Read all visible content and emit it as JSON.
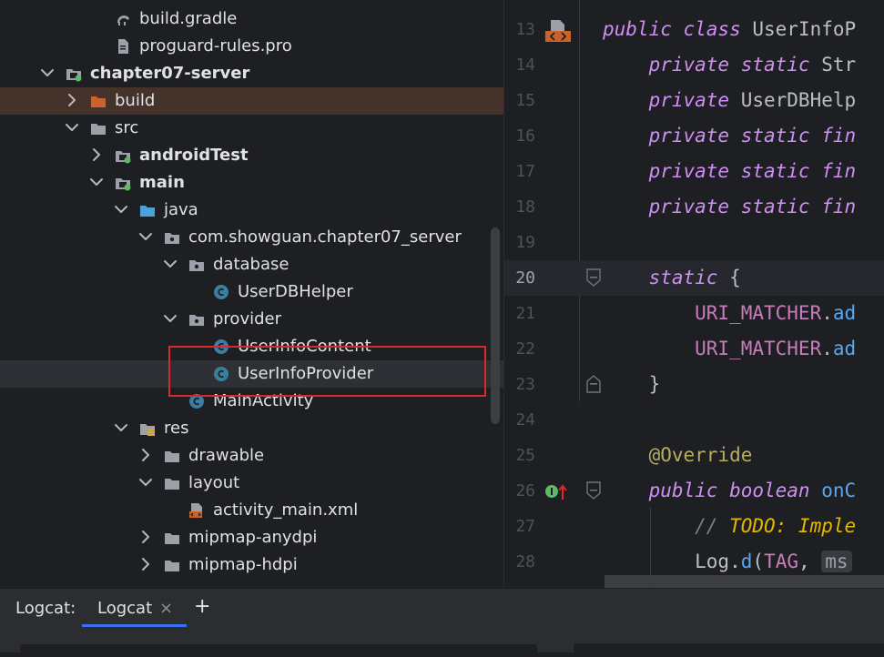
{
  "project_tree": {
    "items": [
      {
        "label": "build.gradle",
        "icon": "gradle-icon",
        "depth": 3,
        "expanded": null,
        "bold": false
      },
      {
        "label": "proguard-rules.pro",
        "icon": "file-icon",
        "depth": 3,
        "expanded": null,
        "bold": false
      },
      {
        "label": "chapter07-server",
        "icon": "module-folder-icon",
        "depth": 1,
        "expanded": true,
        "bold": true
      },
      {
        "label": "build",
        "icon": "build-folder-icon",
        "depth": 2,
        "expanded": false,
        "bold": false
      },
      {
        "label": "src",
        "icon": "folder-icon",
        "depth": 2,
        "expanded": true,
        "bold": false
      },
      {
        "label": "androidTest",
        "icon": "source-set-folder-icon",
        "depth": 3,
        "expanded": false,
        "bold": true
      },
      {
        "label": "main",
        "icon": "source-set-folder-icon",
        "depth": 3,
        "expanded": true,
        "bold": true
      },
      {
        "label": "java",
        "icon": "source-root-folder-icon",
        "depth": 4,
        "expanded": true,
        "bold": false
      },
      {
        "label": "com.showguan.chapter07_server",
        "icon": "package-icon",
        "depth": 5,
        "expanded": true,
        "bold": false
      },
      {
        "label": "database",
        "icon": "package-icon",
        "depth": 6,
        "expanded": true,
        "bold": false
      },
      {
        "label": "UserDBHelper",
        "icon": "class-icon",
        "depth": 7,
        "expanded": null,
        "bold": false
      },
      {
        "label": "provider",
        "icon": "package-icon",
        "depth": 6,
        "expanded": true,
        "bold": false
      },
      {
        "label": "UserInfoContent",
        "icon": "class-icon",
        "depth": 7,
        "expanded": null,
        "bold": false
      },
      {
        "label": "UserInfoProvider",
        "icon": "class-icon",
        "depth": 7,
        "expanded": null,
        "bold": false
      },
      {
        "label": "MainActivity",
        "icon": "class-icon",
        "depth": 6,
        "expanded": null,
        "bold": false
      },
      {
        "label": "res",
        "icon": "resources-folder-icon",
        "depth": 4,
        "expanded": true,
        "bold": false
      },
      {
        "label": "drawable",
        "icon": "folder-icon",
        "depth": 5,
        "expanded": false,
        "bold": false
      },
      {
        "label": "layout",
        "icon": "folder-icon",
        "depth": 5,
        "expanded": true,
        "bold": false
      },
      {
        "label": "activity_main.xml",
        "icon": "layout-xml-icon",
        "depth": 6,
        "expanded": null,
        "bold": false
      },
      {
        "label": "mipmap-anydpi",
        "icon": "folder-icon",
        "depth": 5,
        "expanded": false,
        "bold": false
      },
      {
        "label": "mipmap-hdpi",
        "icon": "folder-icon",
        "depth": 5,
        "expanded": false,
        "bold": false
      }
    ]
  },
  "editor": {
    "current_line": "20",
    "lines": [
      {
        "no": "13",
        "parts": [
          {
            "t": "public class ",
            "c": "kw"
          },
          {
            "t": "UserInfoP",
            "c": "cls"
          }
        ]
      },
      {
        "no": "14",
        "parts": [
          {
            "t": "    private static ",
            "c": "kw"
          },
          {
            "t": "Str",
            "c": "cls"
          }
        ]
      },
      {
        "no": "15",
        "parts": [
          {
            "t": "    private ",
            "c": "kw"
          },
          {
            "t": "UserDBHelp",
            "c": "cls"
          }
        ]
      },
      {
        "no": "16",
        "parts": [
          {
            "t": "    private static fin",
            "c": "kw"
          }
        ]
      },
      {
        "no": "17",
        "parts": [
          {
            "t": "    private static fin",
            "c": "kw"
          }
        ]
      },
      {
        "no": "18",
        "parts": [
          {
            "t": "    private static fin",
            "c": "kw"
          }
        ]
      },
      {
        "no": "19",
        "parts": []
      },
      {
        "no": "20",
        "parts": [
          {
            "t": "    static ",
            "c": "kw"
          },
          {
            "t": "{",
            "c": "cls"
          }
        ]
      },
      {
        "no": "21",
        "parts": [
          {
            "t": "        URI_MATCHER",
            "c": "const"
          },
          {
            "t": ".",
            "c": "cls"
          },
          {
            "t": "ad",
            "c": "mth"
          }
        ]
      },
      {
        "no": "22",
        "parts": [
          {
            "t": "        URI_MATCHER",
            "c": "const"
          },
          {
            "t": ".",
            "c": "cls"
          },
          {
            "t": "ad",
            "c": "mth"
          }
        ]
      },
      {
        "no": "23",
        "parts": [
          {
            "t": "    }",
            "c": "cls"
          }
        ]
      },
      {
        "no": "24",
        "parts": []
      },
      {
        "no": "25",
        "parts": [
          {
            "t": "    @Override",
            "c": "ann"
          }
        ]
      },
      {
        "no": "26",
        "parts": [
          {
            "t": "    public boolean ",
            "c": "kw"
          },
          {
            "t": "onC",
            "c": "mth"
          }
        ]
      },
      {
        "no": "27",
        "parts": [
          {
            "t": "        // ",
            "c": "cmt"
          },
          {
            "t": "TODO: Imple",
            "c": "todo"
          }
        ]
      },
      {
        "no": "28",
        "parts": [
          {
            "t": "        Log",
            "c": "cls"
          },
          {
            "t": ".",
            "c": "cls"
          },
          {
            "t": "d",
            "c": "mth"
          },
          {
            "t": "(",
            "c": "cls"
          },
          {
            "t": "TAG",
            "c": "const"
          },
          {
            "t": ", ",
            "c": "cls"
          },
          {
            "t": "ms",
            "c": "hint"
          }
        ]
      }
    ]
  },
  "bottom_panel": {
    "title": "Logcat:",
    "tabs": [
      {
        "label": "Logcat",
        "close": "×"
      }
    ],
    "add_tab": "+"
  },
  "colors": {
    "highlight_box": "#e0262d",
    "build_row_bg": "#45322b",
    "selected_row_bg": "#2e3036",
    "keyword": "#cf8ef4",
    "method": "#56a8f5",
    "annotation": "#b3ae60",
    "todo": "#e4b700"
  }
}
